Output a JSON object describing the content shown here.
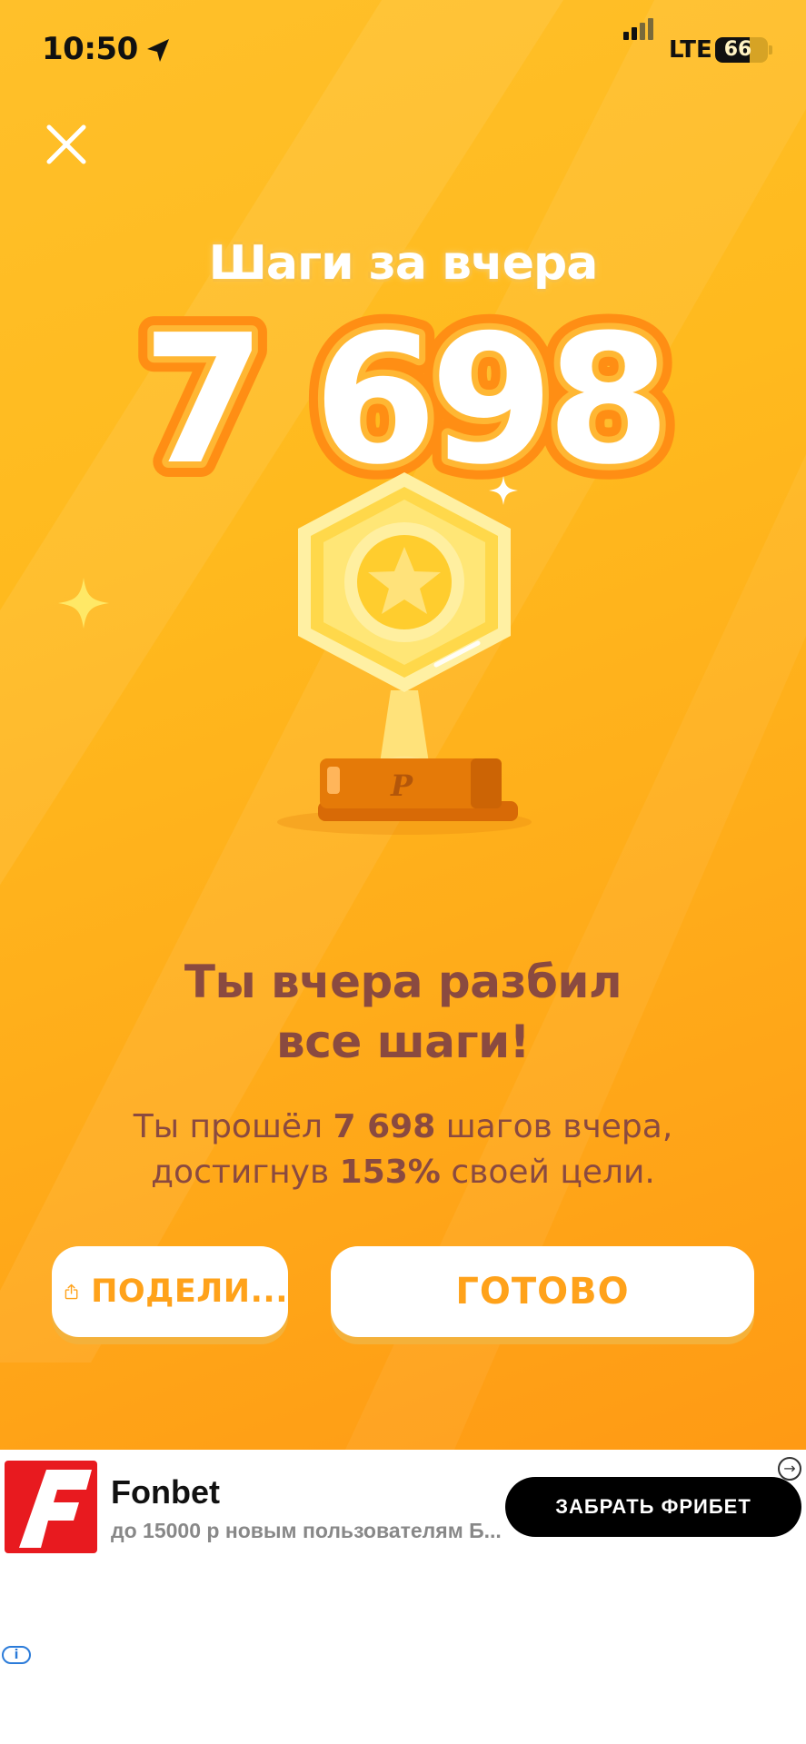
{
  "status_bar": {
    "time": "10:50",
    "network": "LTE",
    "battery": "66",
    "battery_level": 0.66
  },
  "title": "Шаги за вчера",
  "steps": "7 698",
  "headline": {
    "line1": "Ты вчера разбил",
    "line2": "все шаги!"
  },
  "description": {
    "part1": "Ты прошёл ",
    "steps": "7 698",
    "part2": " шагов вчера,",
    "part3": "достигнув ",
    "percent": "153%",
    "part4": " своей цели."
  },
  "buttons": {
    "share": "ПОДЕЛИ...",
    "done": "ГОТОВО"
  },
  "ad": {
    "brand": "Fonbet",
    "subtitle": "до 15000 р новым пользователям Б...",
    "cta": "ЗАБРАТЬ ФРИБЕТ",
    "logo_letter": "F",
    "info": "i"
  },
  "colors": {
    "background": "#ffb81f",
    "accent": "#ffa21a",
    "text": "#8a4a40",
    "ad_brand": "#e81a1f"
  }
}
